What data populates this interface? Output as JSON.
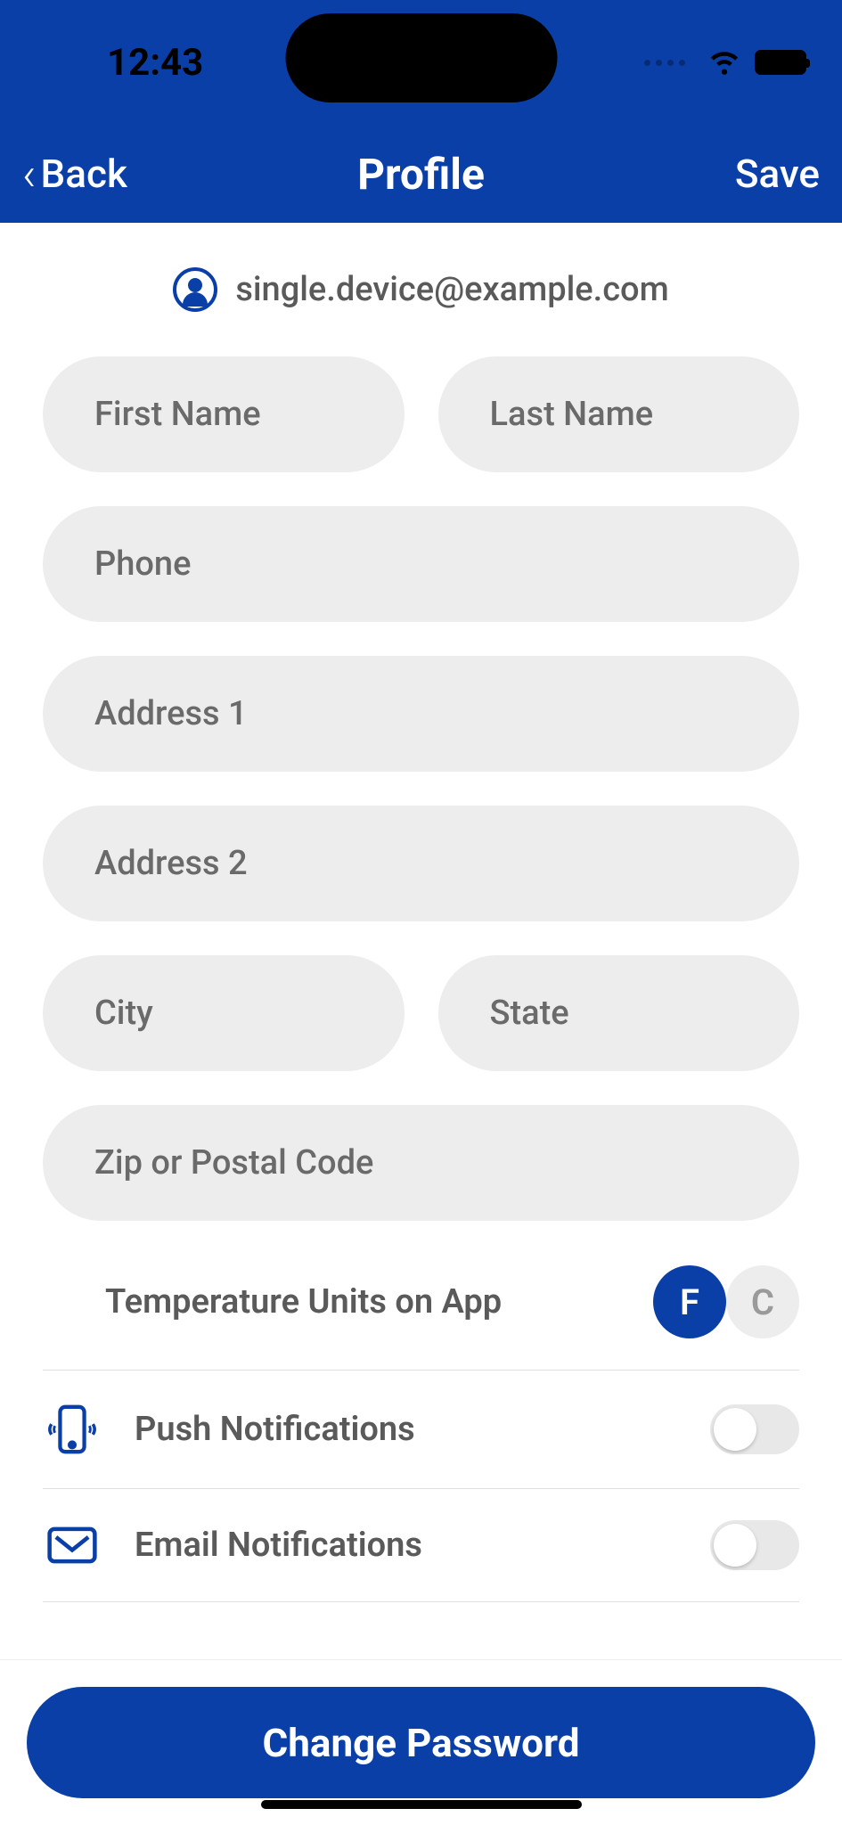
{
  "statusBar": {
    "time": "12:43"
  },
  "nav": {
    "backLabel": "Back",
    "title": "Profile",
    "saveLabel": "Save"
  },
  "profile": {
    "email": "single.device@example.com"
  },
  "fields": {
    "firstName": {
      "placeholder": "First Name",
      "value": ""
    },
    "lastName": {
      "placeholder": "Last Name",
      "value": ""
    },
    "phone": {
      "placeholder": "Phone",
      "value": ""
    },
    "address1": {
      "placeholder": "Address 1",
      "value": ""
    },
    "address2": {
      "placeholder": "Address 2",
      "value": ""
    },
    "city": {
      "placeholder": "City",
      "value": ""
    },
    "state": {
      "placeholder": "State",
      "value": ""
    },
    "zip": {
      "placeholder": "Zip or Postal Code",
      "value": ""
    }
  },
  "settings": {
    "tempLabel": "Temperature Units on App",
    "tempOptions": {
      "f": "F",
      "c": "C"
    },
    "pushLabel": "Push Notifications",
    "emailLabel": "Email Notifications"
  },
  "actions": {
    "changePassword": "Change Password"
  }
}
